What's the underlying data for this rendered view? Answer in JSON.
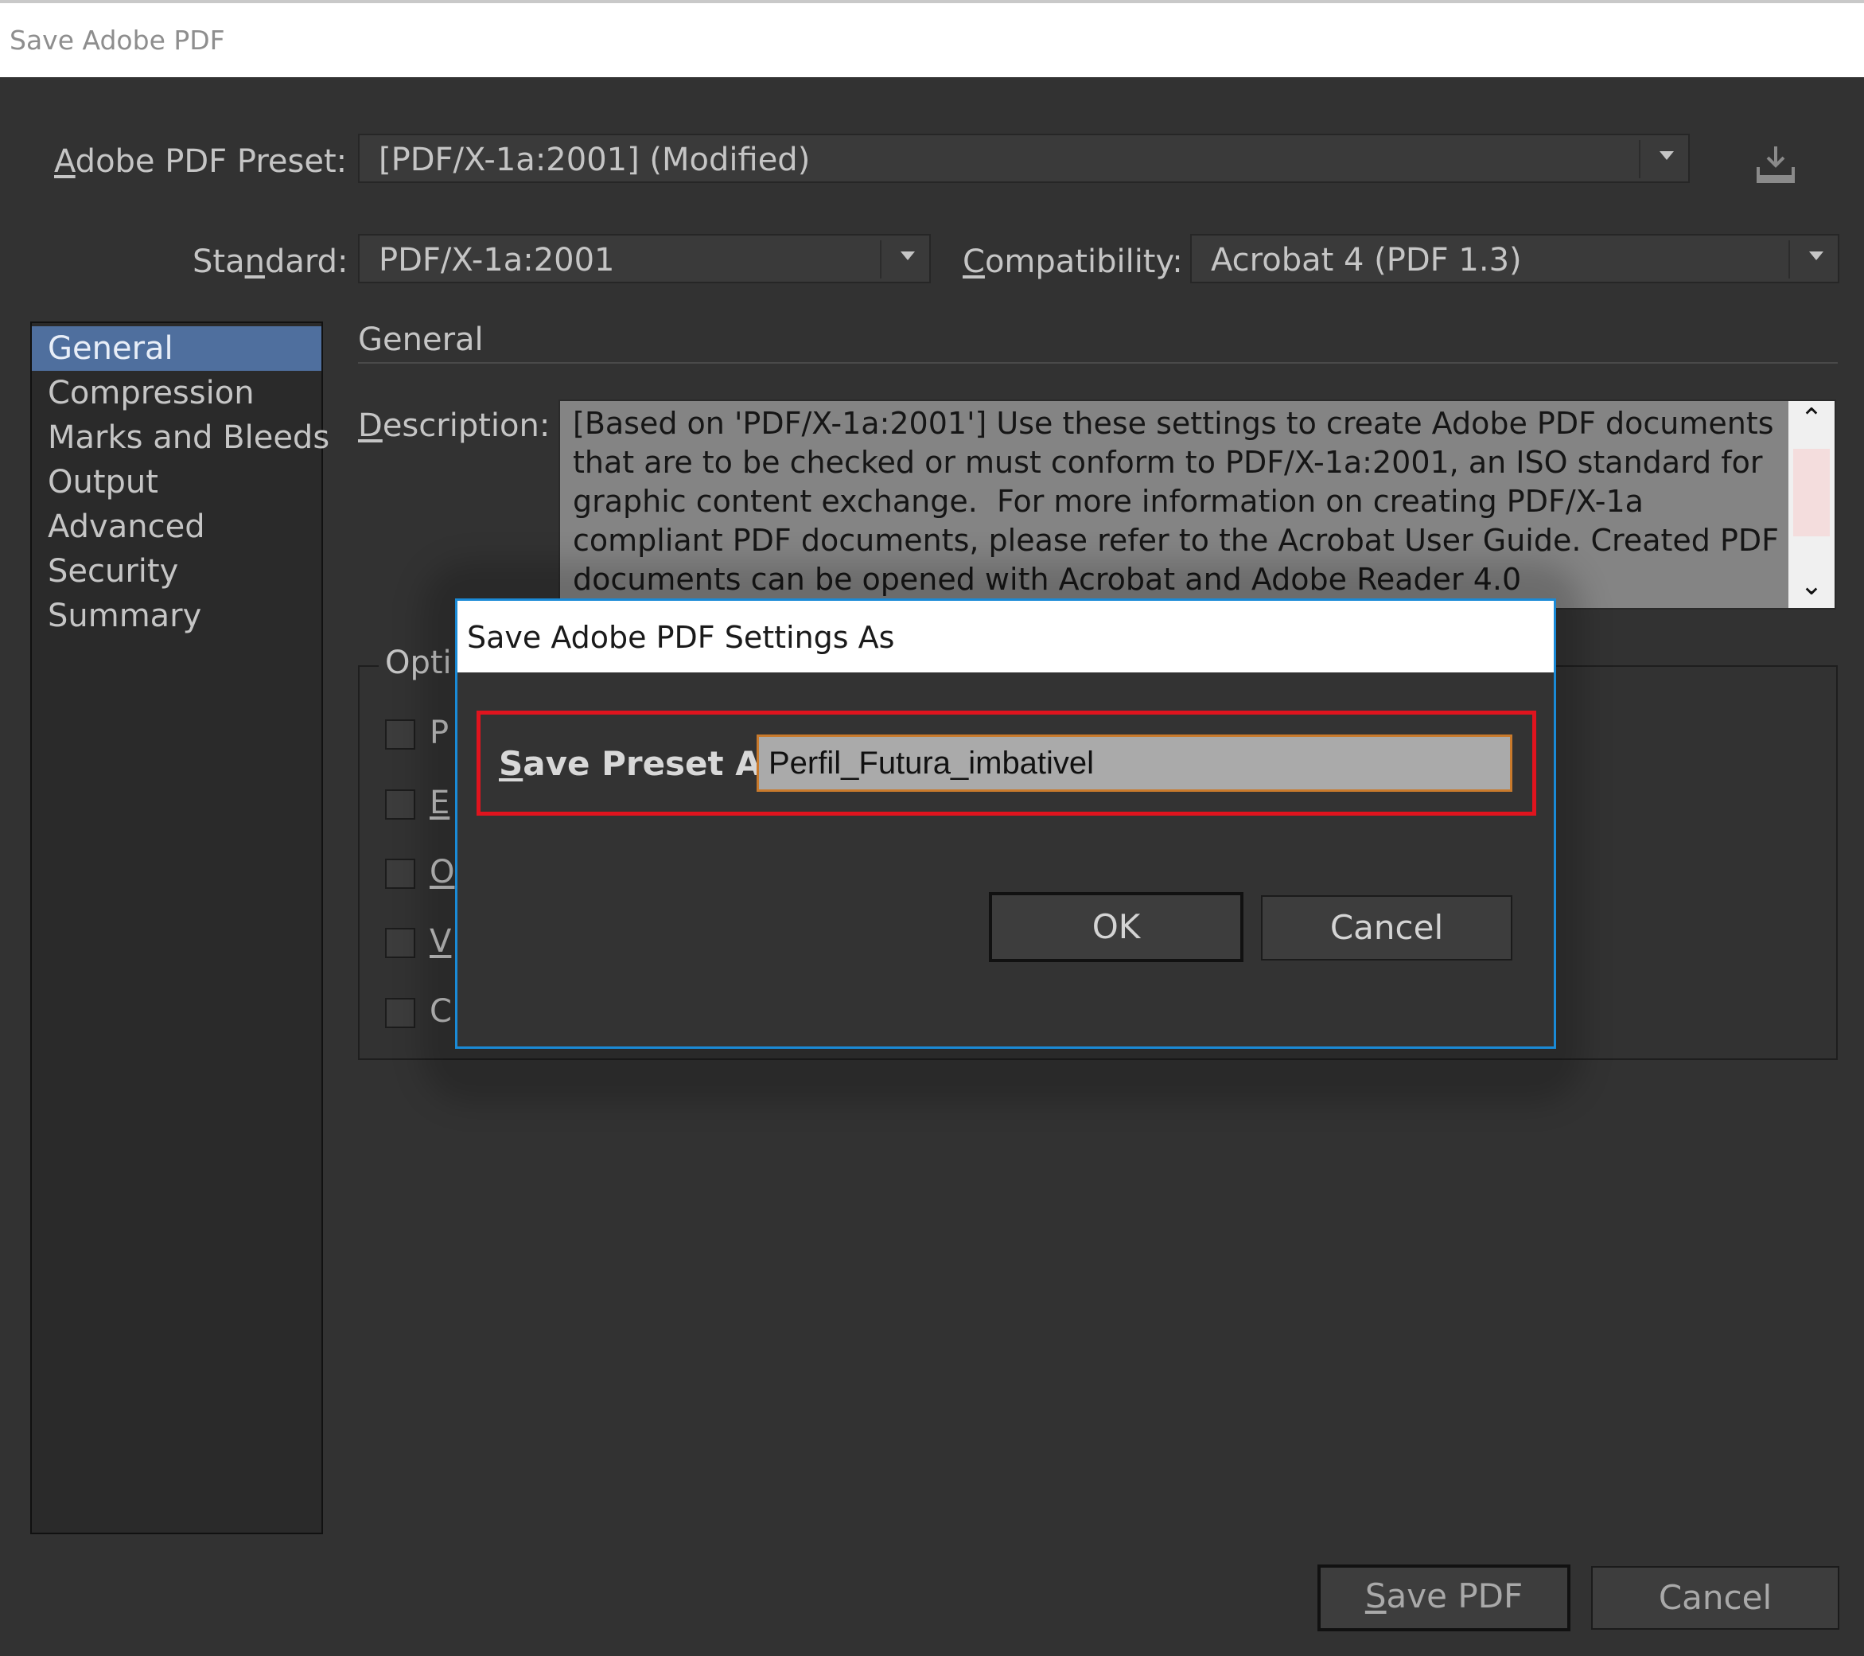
{
  "window": {
    "title": "Save Adobe PDF"
  },
  "preset": {
    "label_access": "A",
    "label_rest": "dobe PDF Preset:",
    "value": "[PDF/X-1a:2001] (Modified)"
  },
  "standard": {
    "label_pre": "Sta",
    "label_access": "n",
    "label_rest": "dard:",
    "value": "PDF/X-1a:2001"
  },
  "compatibility": {
    "label_access": "C",
    "label_rest": "ompatibility:",
    "value": "Acrobat 4 (PDF 1.3)"
  },
  "sidebar": {
    "items": [
      {
        "label": "General"
      },
      {
        "label": "Compression"
      },
      {
        "label": "Marks and Bleeds"
      },
      {
        "label": "Output"
      },
      {
        "label": "Advanced"
      },
      {
        "label": "Security"
      },
      {
        "label": "Summary"
      }
    ]
  },
  "general": {
    "section_title": "General",
    "description_label_access": "D",
    "description_label_rest": "escription:",
    "description_text": "[Based on 'PDF/X-1a:2001'] Use these settings to create Adobe PDF documents that are to be checked or must conform to PDF/X-1a:2001, an ISO standard for graphic content exchange.  For more information on creating PDF/X-1a compliant PDF documents, please refer to the Acrobat User Guide. Created PDF documents can be opened with Acrobat and Adobe Reader 4.0",
    "options_legend": "Opti",
    "options": [
      {
        "label": "P"
      },
      {
        "label": "E"
      },
      {
        "label": "O"
      },
      {
        "label": "V"
      },
      {
        "label": "C"
      }
    ]
  },
  "footer": {
    "save_access": "S",
    "save_rest": "ave PDF",
    "cancel": "Cancel"
  },
  "modal": {
    "title": "Save Adobe PDF Settings As",
    "label_access": "S",
    "label_rest": "ave Preset As:",
    "input_value": "Perfil_Futura_imbativel",
    "ok": "OK",
    "cancel": "Cancel"
  },
  "colors": {
    "dialog_bg": "#323232",
    "selection": "#4f6f9e",
    "modal_border": "#1a8ad6",
    "highlight_red": "#e0141e",
    "input_focus": "#c97a2c"
  },
  "icons": {
    "save_preset": "download-tray-icon",
    "dropdown": "caret-down-icon",
    "scroll_up": "chevron-up-icon",
    "scroll_down": "chevron-down-icon"
  }
}
